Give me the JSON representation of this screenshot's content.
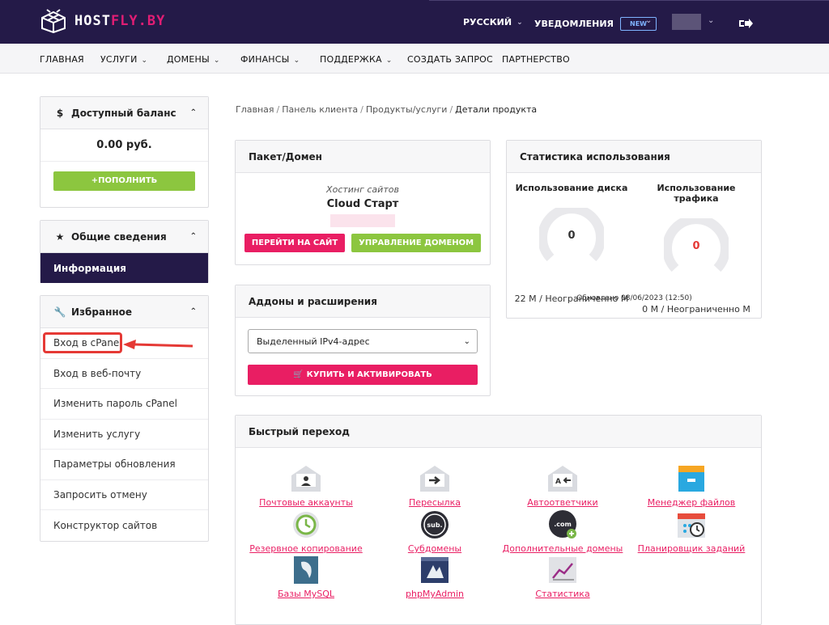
{
  "brand": {
    "name_a": "HOST",
    "name_b": "FLY.BY"
  },
  "top": {
    "language": "РУССКИЙ",
    "notifications": "УВЕДОМЛЕНИЯ",
    "new_badge": "NEW"
  },
  "nav": [
    {
      "label": "ГЛАВНАЯ",
      "dropdown": false
    },
    {
      "label": "УСЛУГИ",
      "dropdown": true
    },
    {
      "label": "ДОМЕНЫ",
      "dropdown": true
    },
    {
      "label": "ФИНАНСЫ",
      "dropdown": true
    },
    {
      "label": "ПОДДЕРЖКА",
      "dropdown": true
    },
    {
      "label": "СОЗДАТЬ ЗАПРОС",
      "dropdown": false
    },
    {
      "label": "ПАРТНЕРСТВО",
      "dropdown": false
    }
  ],
  "sidebar": {
    "balance": {
      "title": "Доступный баланс",
      "value": "0.00 руб.",
      "button": "ПОПОЛНИТЬ"
    },
    "overview": {
      "title": "Общие сведения",
      "active_item": "Информация"
    },
    "favorites": {
      "title": "Избранное",
      "items": [
        "Вход в cPanel",
        "Вход в веб-почту",
        "Изменить пароль cPanel",
        "Изменить услугу",
        "Параметры обновления",
        "Запросить отмену",
        "Конструктор сайтов"
      ]
    }
  },
  "breadcrumb": [
    "Главная",
    "Панель клиента",
    "Продукты/услуги",
    "Детали продукта"
  ],
  "package": {
    "title": "Пакет/Домен",
    "subtitle": "Хостинг сайтов",
    "name": "Cloud Старт",
    "btn_site": "ПЕРЕЙТИ НА САЙТ",
    "btn_domain": "УПРАВЛЕНИЕ ДОМЕНОМ"
  },
  "addons": {
    "title": "Аддоны и расширения",
    "selected": "Выделенный IPv4-адрес",
    "buy": "КУПИТЬ И АКТИВИРОВАТЬ"
  },
  "stats": {
    "title": "Статистика использования",
    "disk": {
      "title": "Использование диска",
      "value": "0",
      "usage": "22 M / Неограниченно M"
    },
    "traffic": {
      "title": "Использование трафика",
      "value": "0",
      "usage": "0 M / Неограниченно M"
    },
    "updated": "Обновлено 08/06/2023 (12:50)"
  },
  "quick": {
    "title": "Быстрый переход",
    "items": [
      {
        "label": "Почтовые аккаунты",
        "icon": "mail-account-icon"
      },
      {
        "label": "Пересылка",
        "icon": "mail-forward-icon"
      },
      {
        "label": "Автоответчики",
        "icon": "autoresponder-icon"
      },
      {
        "label": "Менеджер файлов",
        "icon": "file-manager-icon"
      },
      {
        "label": "Резервное копирование",
        "icon": "backup-icon"
      },
      {
        "label": "Субдомены",
        "icon": "subdomain-icon"
      },
      {
        "label": "Дополнительные домены",
        "icon": "addon-domain-icon"
      },
      {
        "label": "Планировщик заданий",
        "icon": "cron-icon"
      },
      {
        "label": "Базы MySQL",
        "icon": "mysql-icon"
      },
      {
        "label": "phpMyAdmin",
        "icon": "phpmyadmin-icon"
      },
      {
        "label": "Статистика",
        "icon": "statistics-icon"
      }
    ]
  },
  "colors": {
    "header": "#241a48",
    "accent": "#e91e63",
    "green": "#8cc63f"
  }
}
